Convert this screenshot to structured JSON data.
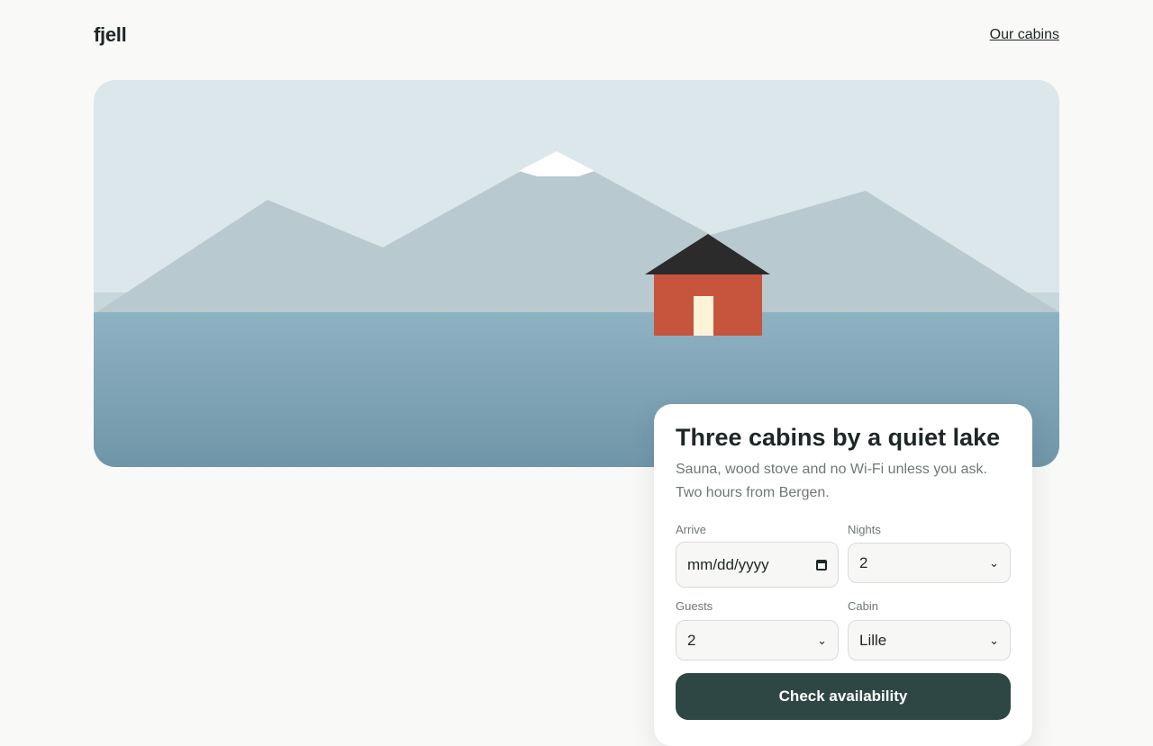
{
  "header": {
    "logo": "fjell",
    "nav_link": "Our cabins"
  },
  "hero": {
    "colors": {
      "sky": "#dce7ec",
      "mountains": "#b8cad0",
      "snow": "#ffffff",
      "water_top": "#8fb2c3",
      "water_bottom": "#6f96a8",
      "cabin_wall": "#c7553d",
      "cabin_roof": "#2b2b2b",
      "cabin_door": "#fdf3d8"
    }
  },
  "booking": {
    "title": "Three cabins by a quiet lake",
    "subtitle": "Sauna, wood stove and no Wi-Fi unless you ask. Two hours from Bergen.",
    "arrive": {
      "label": "Arrive",
      "placeholder": "mm/dd/yyyy"
    },
    "nights": {
      "label": "Nights",
      "value": "2"
    },
    "guests": {
      "label": "Guests",
      "value": "2"
    },
    "cabin": {
      "label": "Cabin",
      "value": "Lille"
    },
    "submit": "Check availability"
  },
  "colors": {
    "background": "#f9f9f7",
    "text": "#1e2626",
    "muted": "#6f7777",
    "accent": "#2f4744"
  }
}
